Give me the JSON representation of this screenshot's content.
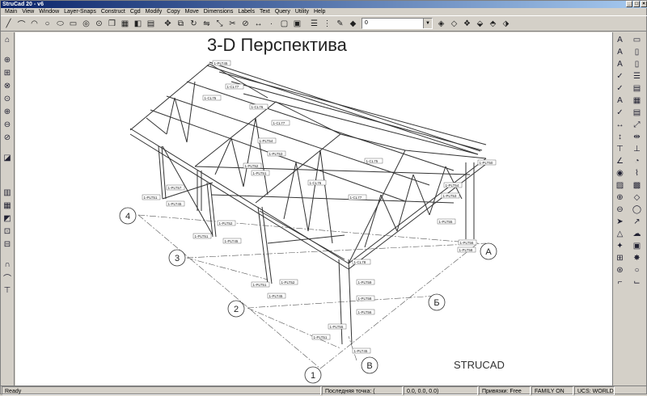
{
  "window": {
    "title": "StruCad 20 - v6"
  },
  "menu": [
    "Main",
    "View",
    "Window",
    "Layer-Snaps",
    "Construct",
    "Cgd",
    "Modify",
    "Copy",
    "Move",
    "Dimensions",
    "Labels",
    "Text",
    "Query",
    "Utility",
    "Help"
  ],
  "toolbar": {
    "layer_value": "0"
  },
  "drawing": {
    "title": "3-D Перспектива",
    "watermark": "STRUCAD",
    "grid_labels": [
      "4",
      "3",
      "2",
      "1",
      "A",
      "Б",
      "В"
    ],
    "part_labels": [
      "1-PLT45",
      "1-PLT52",
      "1-CL77",
      "1-CL75",
      "1-CL76",
      "1-PLT54",
      "1-PLT53",
      "1-PLT51",
      "1-PLT50",
      "1-PLT55",
      "1-PLT56",
      "1-PLT58",
      "1-PLT57",
      "1-CL78",
      "1-PLT59"
    ]
  },
  "status": {
    "left": "Ready",
    "last_point_label": "Последняя точка: (",
    "coords": "0.0,        0.0,        0.0)",
    "snap": "Привязки:   Free",
    "family": "FAMILY ON",
    "ucs": "UCS: WORLD"
  },
  "colors": {
    "titlebar": "#0a246a",
    "face": "#d4d0c8",
    "canvas": "#ffffff"
  }
}
